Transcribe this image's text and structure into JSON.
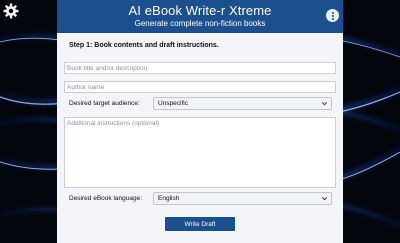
{
  "header": {
    "title": "AI eBook Write-r Xtreme",
    "subtitle": "Generate complete non-fiction books"
  },
  "form": {
    "step_heading": "Step 1: Book contents and draft instructions.",
    "book_title": {
      "value": "",
      "placeholder": "Book title and/or description"
    },
    "author_name": {
      "value": "",
      "placeholder": "Author name"
    },
    "target_audience": {
      "label": "Desired target audience:",
      "selected": "Unspecific"
    },
    "additional_instructions": {
      "value": "",
      "placeholder": "Additional instructions (optional)"
    },
    "language": {
      "label": "Desired eBook language:",
      "selected": "English"
    },
    "write_button_label": "Write Draft"
  },
  "icons": {
    "settings": "gear-icon",
    "menu": "vertical-dots-icon",
    "dropdown": "chevron-down-icon"
  },
  "colors": {
    "header": "#1c4f8d",
    "button": "#1c4f8d",
    "panel": "#f3f5f8",
    "background": "#05070f",
    "glow": "#3a7bff"
  }
}
